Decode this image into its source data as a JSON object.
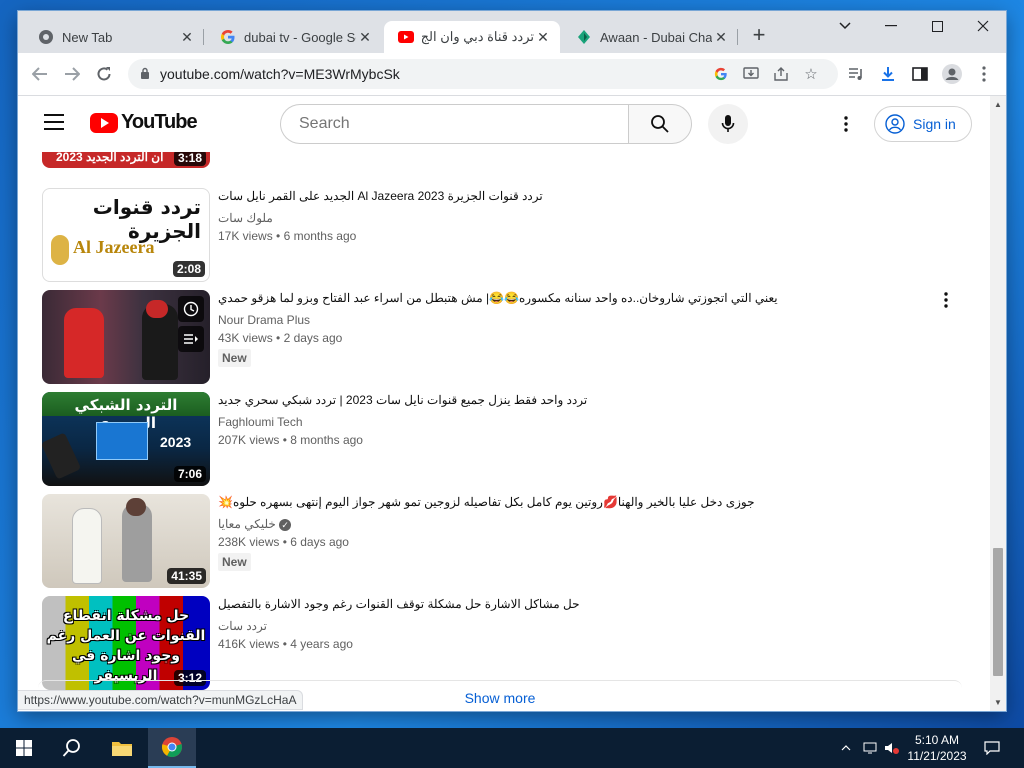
{
  "browser": {
    "tabs": [
      {
        "title": "New Tab",
        "active": false
      },
      {
        "title": "dubai tv - Google Se",
        "active": false
      },
      {
        "title": "تردد قناة دبي وان الج",
        "active": true
      },
      {
        "title": "Awaan - Dubai Chan",
        "active": false
      }
    ],
    "url": "youtube.com/watch?v=ME3WrMybcSk",
    "status_url": "https://www.youtube.com/watch?v=munMGzLcHaA"
  },
  "youtube": {
    "logo": "YouTube",
    "search_placeholder": "Search",
    "signin_label": "Sign in",
    "show_more_label": "Show more",
    "partial_item": {
      "thumb_text": "ان التردد الجديد 2023",
      "duration": "3:18"
    },
    "videos": [
      {
        "title": "الجديد على القمر نايل سات Al Jazeera 2023 تردد قنوات الجزيرة",
        "channel": "ملوك سات",
        "views": "17K views",
        "age": "6 months ago",
        "badge": "",
        "duration": "2:08",
        "thumb_text": "تردد قنوات الجزيرة",
        "thumb_sub": "Al Jazeera"
      },
      {
        "title": "يعني التي اتجوزتي شاروخان..ده واحد سنانه مكسوره😂😂| مش هتبطل من اسراء عبد الفتاح وبزو لما هزقو حمدي",
        "channel": "Nour Drama Plus",
        "views": "43K views",
        "age": "2 days ago",
        "badge": "New",
        "duration": "",
        "thumb_text": "",
        "thumb_sub": ""
      },
      {
        "title": "تردد واحد فقط ينزل جميع قنوات نايل سات 2023 | تردد شبكي سحري جديد",
        "channel": "Faghloumi Tech",
        "views": "207K views",
        "age": "8 months ago",
        "badge": "",
        "duration": "7:06",
        "thumb_text": "التردد الشبكي السحري",
        "thumb_sub": "2023"
      },
      {
        "title": "💥جوزى دخل عليا بالخير والهنا💋روتين يوم كامل بكل تفاصيله لزوجين تمو شهر جواز اليوم إنتهى بسهره حلوه",
        "channel": "خليكي معايا",
        "views": "238K views",
        "age": "6 days ago",
        "badge": "New",
        "duration": "41:35",
        "thumb_text": "",
        "thumb_sub": ""
      },
      {
        "title": "حل مشاكل الاشارة حل مشكلة توقف القنوات رغم وجود الاشارة بالتفصيل",
        "channel": "تردد سات",
        "views": "416K views",
        "age": "4 years ago",
        "badge": "",
        "duration": "3:12",
        "thumb_text": "حل مشكلة انقطاع القنوات عن العمل رغم وجود اشارة في الريسيفر",
        "thumb_sub": ""
      }
    ]
  },
  "taskbar": {
    "time": "5:10 AM",
    "date": "11/21/2023"
  }
}
